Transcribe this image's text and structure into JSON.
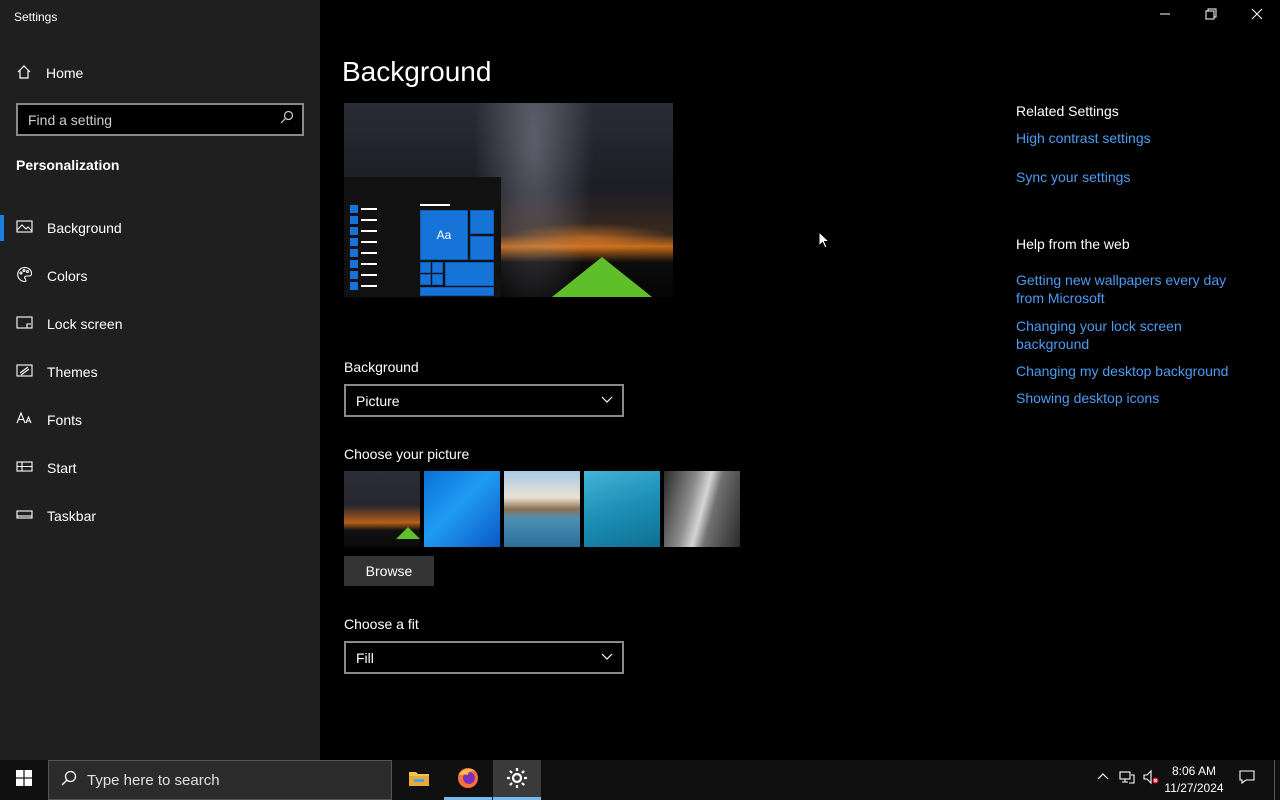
{
  "window": {
    "title": "Settings",
    "controls": {
      "minimize": "minimize",
      "restore": "restore",
      "close": "close"
    }
  },
  "sidebar": {
    "home_label": "Home",
    "search_placeholder": "Find a setting",
    "section_label": "Personalization",
    "items": [
      {
        "label": "Background",
        "icon": "image-icon",
        "active": true
      },
      {
        "label": "Colors",
        "icon": "palette-icon",
        "active": false
      },
      {
        "label": "Lock screen",
        "icon": "lock-screen-icon",
        "active": false
      },
      {
        "label": "Themes",
        "icon": "themes-icon",
        "active": false
      },
      {
        "label": "Fonts",
        "icon": "fonts-icon",
        "active": false
      },
      {
        "label": "Start",
        "icon": "start-icon",
        "active": false
      },
      {
        "label": "Taskbar",
        "icon": "taskbar-icon",
        "active": false
      }
    ]
  },
  "main": {
    "title": "Background",
    "preview_tile_text": "Aa",
    "background_label": "Background",
    "background_value": "Picture",
    "choose_picture_label": "Choose your picture",
    "browse_label": "Browse",
    "fit_label": "Choose a fit",
    "fit_value": "Fill"
  },
  "related": {
    "heading": "Related Settings",
    "links": [
      "High contrast settings",
      "Sync your settings"
    ]
  },
  "help": {
    "heading": "Help from the web",
    "links": [
      "Getting new wallpapers every day from Microsoft",
      "Changing your lock screen background",
      "Changing my desktop background",
      "Showing desktop icons"
    ]
  },
  "taskbar": {
    "search_placeholder": "Type here to search",
    "apps": [
      "file-explorer-icon",
      "firefox-icon",
      "settings-gear-icon"
    ],
    "time": "8:06 AM",
    "date": "11/27/2024"
  },
  "colors": {
    "accent": "#1a7fe0",
    "link": "#4c9cf2",
    "sidebar_bg": "#1f1f1f",
    "content_bg": "#000000"
  }
}
